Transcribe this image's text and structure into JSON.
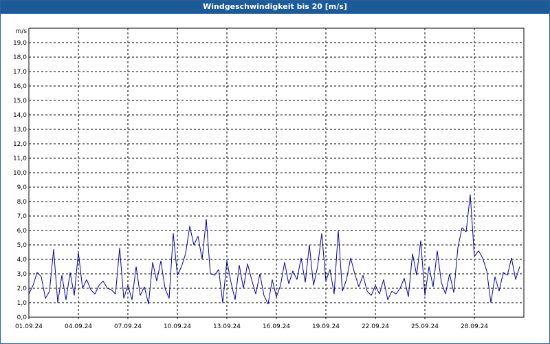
{
  "window": {
    "title": "Windgeschwindigkeit bis 20 [m/s]"
  },
  "chart_data": {
    "type": "line",
    "title": "Windgeschwindigkeit bis 20 [m/s]",
    "ylabel": "m/s",
    "xlabel": "",
    "ylim": [
      0,
      20
    ],
    "xlim": [
      "2024-09-01",
      "2024-10-01"
    ],
    "y_ticks": [
      "0,0",
      "1,0",
      "2,0",
      "3,0",
      "4,0",
      "5,0",
      "6,0",
      "7,0",
      "8,0",
      "9,0",
      "10,0",
      "11,0",
      "12,0",
      "13,0",
      "14,0",
      "15,0",
      "16,0",
      "17,0",
      "18,0",
      "19,0"
    ],
    "x_ticks": [
      "01.09.24",
      "04.09.24",
      "07.09.24",
      "10.09.24",
      "13.09.24",
      "16.09.24",
      "19.09.24",
      "22.09.24",
      "25.09.24",
      "28.09.24"
    ],
    "grid": true,
    "line_color": "#0000a0",
    "series": [
      {
        "values": [
          [
            "2024-09-01 00:00",
            1.6
          ],
          [
            "2024-09-01 06:00",
            2.2
          ],
          [
            "2024-09-01 12:00",
            3.1
          ],
          [
            "2024-09-01 18:00",
            2.8
          ],
          [
            "2024-09-02 00:00",
            1.3
          ],
          [
            "2024-09-02 06:00",
            1.8
          ],
          [
            "2024-09-02 12:00",
            4.7
          ],
          [
            "2024-09-02 18:00",
            1.0
          ],
          [
            "2024-09-03 00:00",
            2.9
          ],
          [
            "2024-09-03 06:00",
            1.2
          ],
          [
            "2024-09-03 12:00",
            3.1
          ],
          [
            "2024-09-03 18:00",
            1.5
          ],
          [
            "2024-09-04 00:00",
            4.5
          ],
          [
            "2024-09-04 06:00",
            2.0
          ],
          [
            "2024-09-04 12:00",
            2.6
          ],
          [
            "2024-09-04 18:00",
            1.9
          ],
          [
            "2024-09-05 00:00",
            1.6
          ],
          [
            "2024-09-05 06:00",
            2.2
          ],
          [
            "2024-09-05 12:00",
            2.5
          ],
          [
            "2024-09-05 18:00",
            2.0
          ],
          [
            "2024-09-06 00:00",
            1.9
          ],
          [
            "2024-09-06 06:00",
            1.6
          ],
          [
            "2024-09-06 12:00",
            4.8
          ],
          [
            "2024-09-06 18:00",
            1.3
          ],
          [
            "2024-09-07 00:00",
            2.2
          ],
          [
            "2024-09-07 06:00",
            1.2
          ],
          [
            "2024-09-07 12:00",
            3.5
          ],
          [
            "2024-09-07 18:00",
            1.5
          ],
          [
            "2024-09-08 00:00",
            2.1
          ],
          [
            "2024-09-08 06:00",
            0.9
          ],
          [
            "2024-09-08 12:00",
            3.8
          ],
          [
            "2024-09-08 18:00",
            2.5
          ],
          [
            "2024-09-09 00:00",
            3.9
          ],
          [
            "2024-09-09 06:00",
            2.0
          ],
          [
            "2024-09-09 12:00",
            1.3
          ],
          [
            "2024-09-09 18:00",
            5.8
          ],
          [
            "2024-09-10 00:00",
            2.9
          ],
          [
            "2024-09-10 06:00",
            3.5
          ],
          [
            "2024-09-10 12:00",
            4.4
          ],
          [
            "2024-09-10 18:00",
            6.3
          ],
          [
            "2024-09-11 00:00",
            5.0
          ],
          [
            "2024-09-11 06:00",
            5.6
          ],
          [
            "2024-09-11 12:00",
            4.0
          ],
          [
            "2024-09-11 18:00",
            6.8
          ],
          [
            "2024-09-12 00:00",
            3.0
          ],
          [
            "2024-09-12 06:00",
            2.9
          ],
          [
            "2024-09-12 12:00",
            3.3
          ],
          [
            "2024-09-12 18:00",
            1.0
          ],
          [
            "2024-09-13 00:00",
            3.9
          ],
          [
            "2024-09-13 06:00",
            2.4
          ],
          [
            "2024-09-13 12:00",
            1.2
          ],
          [
            "2024-09-13 18:00",
            3.6
          ],
          [
            "2024-09-14 00:00",
            2.0
          ],
          [
            "2024-09-14 06:00",
            3.7
          ],
          [
            "2024-09-14 12:00",
            2.6
          ],
          [
            "2024-09-14 18:00",
            1.6
          ],
          [
            "2024-09-15 00:00",
            3.0
          ],
          [
            "2024-09-15 06:00",
            1.5
          ],
          [
            "2024-09-15 12:00",
            0.9
          ],
          [
            "2024-09-15 18:00",
            2.6
          ],
          [
            "2024-09-16 00:00",
            1.4
          ],
          [
            "2024-09-16 06:00",
            2.2
          ],
          [
            "2024-09-16 12:00",
            3.8
          ],
          [
            "2024-09-16 18:00",
            2.3
          ],
          [
            "2024-09-17 00:00",
            3.2
          ],
          [
            "2024-09-17 06:00",
            2.6
          ],
          [
            "2024-09-17 12:00",
            4.1
          ],
          [
            "2024-09-17 18:00",
            2.4
          ],
          [
            "2024-09-18 00:00",
            5.0
          ],
          [
            "2024-09-18 06:00",
            2.2
          ],
          [
            "2024-09-18 12:00",
            3.5
          ],
          [
            "2024-09-18 18:00",
            5.8
          ],
          [
            "2024-09-19 00:00",
            2.5
          ],
          [
            "2024-09-19 06:00",
            3.3
          ],
          [
            "2024-09-19 12:00",
            1.6
          ],
          [
            "2024-09-19 18:00",
            6.0
          ],
          [
            "2024-09-20 00:00",
            1.8
          ],
          [
            "2024-09-20 06:00",
            2.6
          ],
          [
            "2024-09-20 12:00",
            4.1
          ],
          [
            "2024-09-20 18:00",
            3.0
          ],
          [
            "2024-09-21 00:00",
            2.1
          ],
          [
            "2024-09-21 06:00",
            2.9
          ],
          [
            "2024-09-21 12:00",
            1.8
          ],
          [
            "2024-09-21 18:00",
            1.5
          ],
          [
            "2024-09-22 00:00",
            2.2
          ],
          [
            "2024-09-22 06:00",
            1.6
          ],
          [
            "2024-09-22 12:00",
            2.6
          ],
          [
            "2024-09-22 18:00",
            1.2
          ],
          [
            "2024-09-23 00:00",
            1.8
          ],
          [
            "2024-09-23 06:00",
            1.6
          ],
          [
            "2024-09-23 12:00",
            2.0
          ],
          [
            "2024-09-23 18:00",
            2.7
          ],
          [
            "2024-09-24 00:00",
            1.4
          ],
          [
            "2024-09-24 06:00",
            4.4
          ],
          [
            "2024-09-24 12:00",
            2.9
          ],
          [
            "2024-09-24 18:00",
            5.3
          ],
          [
            "2024-09-25 00:00",
            1.5
          ],
          [
            "2024-09-25 06:00",
            3.5
          ],
          [
            "2024-09-25 12:00",
            2.1
          ],
          [
            "2024-09-25 18:00",
            4.6
          ],
          [
            "2024-09-26 00:00",
            2.4
          ],
          [
            "2024-09-26 06:00",
            1.6
          ],
          [
            "2024-09-26 12:00",
            3.0
          ],
          [
            "2024-09-26 18:00",
            1.7
          ],
          [
            "2024-09-27 00:00",
            4.8
          ],
          [
            "2024-09-27 06:00",
            6.2
          ],
          [
            "2024-09-27 12:00",
            5.9
          ],
          [
            "2024-09-27 18:00",
            8.5
          ],
          [
            "2024-09-28 00:00",
            4.2
          ],
          [
            "2024-09-28 06:00",
            4.6
          ],
          [
            "2024-09-28 12:00",
            4.1
          ],
          [
            "2024-09-28 18:00",
            3.2
          ],
          [
            "2024-09-29 00:00",
            1.0
          ],
          [
            "2024-09-29 06:00",
            2.8
          ],
          [
            "2024-09-29 12:00",
            1.8
          ],
          [
            "2024-09-29 18:00",
            3.1
          ],
          [
            "2024-09-30 00:00",
            2.9
          ],
          [
            "2024-09-30 06:00",
            4.1
          ],
          [
            "2024-09-30 12:00",
            2.6
          ],
          [
            "2024-09-30 18:00",
            3.5
          ]
        ]
      }
    ]
  }
}
